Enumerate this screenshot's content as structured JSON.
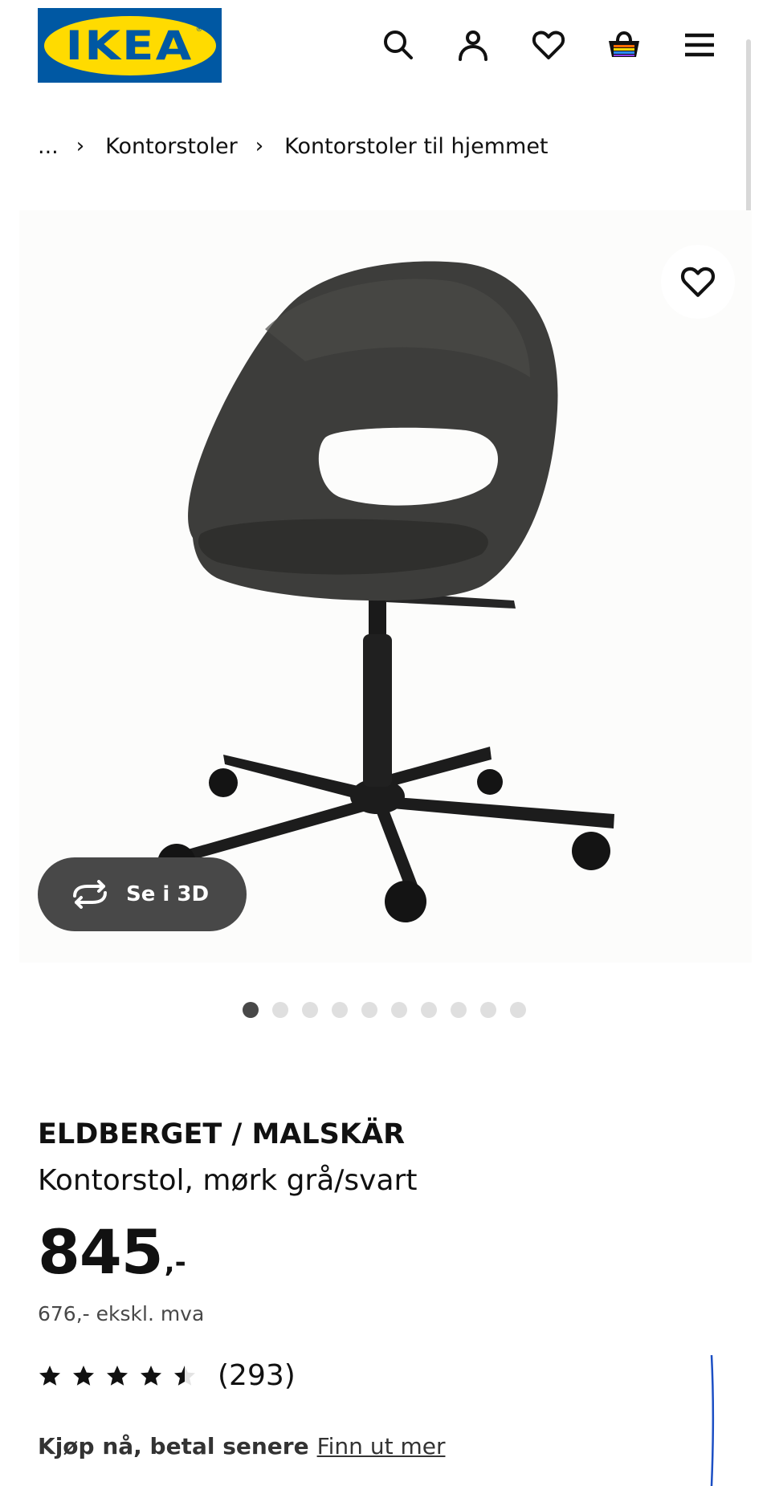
{
  "header": {
    "logo_text": "IKEA",
    "logo_mark": "®",
    "icons": [
      "search-icon",
      "user-icon",
      "heart-icon",
      "basket-icon",
      "menu-icon"
    ]
  },
  "breadcrumb": {
    "ellipsis": "...",
    "items": [
      "Kontorstoler",
      "Kontorstoler til hjemmet"
    ]
  },
  "gallery": {
    "view_3d_label": "Se i 3D",
    "total_images": 10,
    "active_index": 0
  },
  "product": {
    "name": "ELDBERGET / MALSKÄR",
    "description": "Kontorstol, mørk grå/svart",
    "price_integer": "845",
    "price_suffix": ",-",
    "price_ex_vat": "676,- ekskl. mva",
    "rating_stars": 4.5,
    "rating_max": 5,
    "review_count": "(293)"
  },
  "payment": {
    "headline": "Kjøp nå, betal senere",
    "link": "Finn ut mer"
  },
  "colors": {
    "ikea_blue": "#0058a3",
    "ikea_yellow": "#ffdb00",
    "chair_seat": "#3d3d3b",
    "chair_base": "#1c1c1c"
  }
}
